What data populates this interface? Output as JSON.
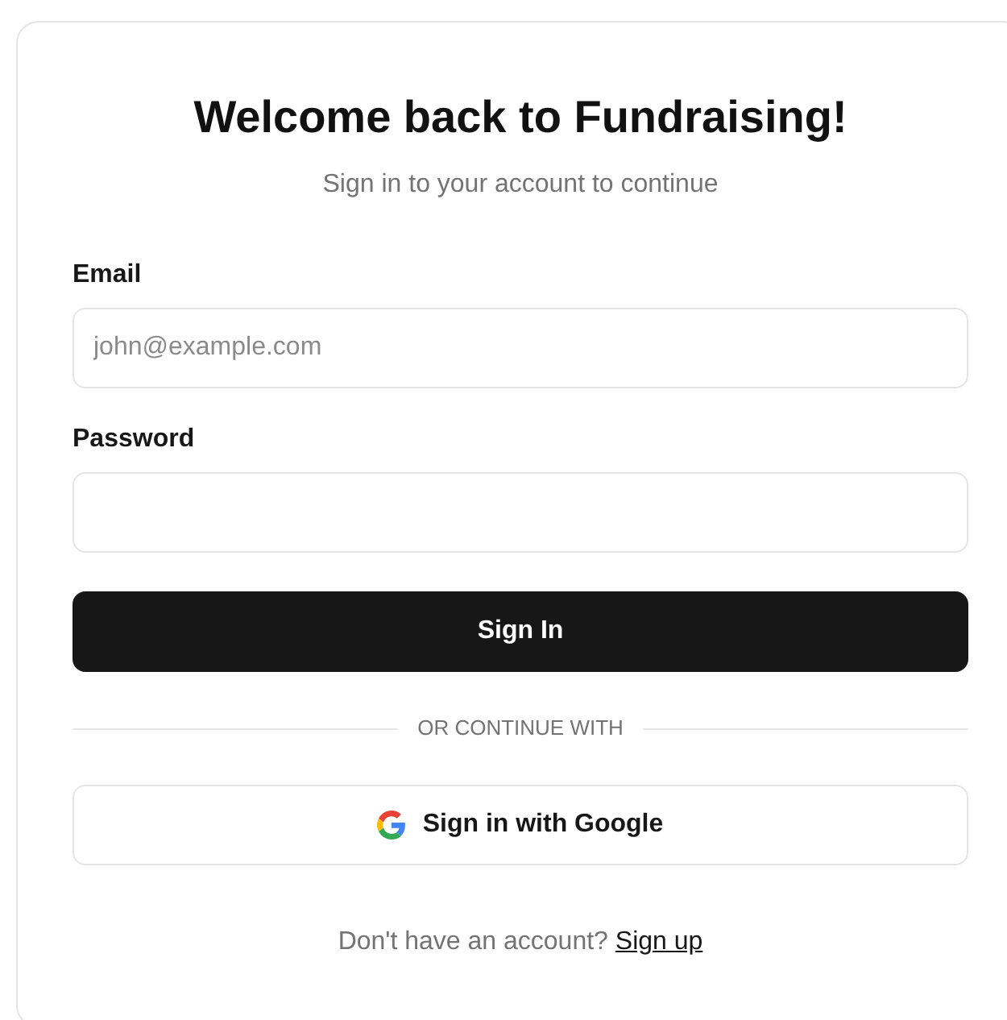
{
  "title": "Welcome back to Fundraising!",
  "subtitle": "Sign in to your account to continue",
  "fields": [
    {
      "label": "Email",
      "placeholder": "john@example.com"
    },
    {
      "label": "Password"
    }
  ],
  "submit": "Sign In",
  "divider": "OR CONTINUE WITH",
  "google_button": "Sign in with Google",
  "footer": {
    "text": "Don't have an account?",
    "link": "Sign up"
  }
}
